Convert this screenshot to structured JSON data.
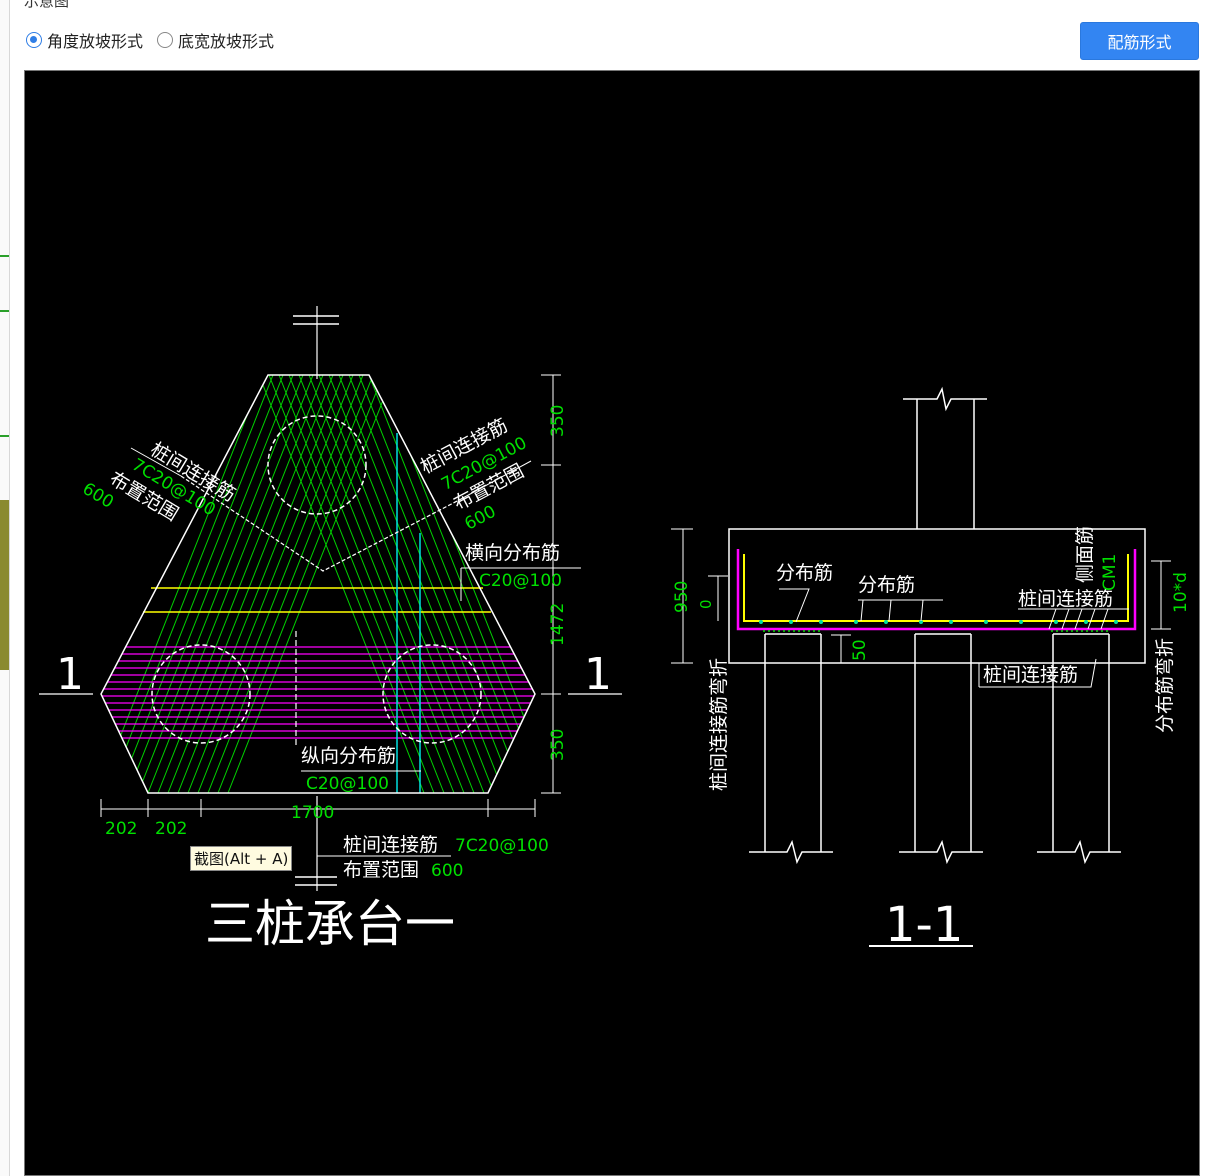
{
  "header": {
    "title": "示意图",
    "options": [
      {
        "label": "角度放坡形式",
        "checked": true
      },
      {
        "label": "底宽放坡形式",
        "checked": false
      }
    ],
    "button_label": "配筋形式"
  },
  "plan": {
    "title": "三桩承台一",
    "section_marks": [
      "1",
      "1"
    ],
    "dims": {
      "top": "350",
      "mid": "1472",
      "bottom": "350",
      "width": "1700",
      "edge_left": "202",
      "edge_right": "202"
    },
    "left_note": {
      "label": "桩间连接筋",
      "spec": "7C20@100",
      "range_label": "布置范围",
      "range_value": "600"
    },
    "right_note": {
      "label": "桩间连接筋",
      "spec": "7C20@100",
      "range_label": "布置范围",
      "range_value": "600"
    },
    "transverse": {
      "label": "横向分布筋",
      "spec": "C20@100"
    },
    "longitudinal": {
      "label": "纵向分布筋",
      "spec": "C20@100"
    },
    "bottom_note": {
      "label": "桩间连接筋",
      "spec": "7C20@100",
      "range_label": "布置范围",
      "range_value": "600"
    }
  },
  "section": {
    "title": "1-1",
    "dims": {
      "height": "950",
      "cover": "0",
      "embed": "50",
      "bend": "10*d"
    },
    "labels": {
      "dist1": "分布筋",
      "dist2": "分布筋",
      "side": "侧面筋",
      "side_spec": "CM1",
      "conn_top": "桩间连接筋",
      "conn_bottom": "桩间连接筋",
      "left_vertical": "桩间连接筋弯折",
      "right_vertical": "分布筋弯折"
    }
  },
  "tooltip": "截图(Alt + A)",
  "colors": {
    "green": "#00e000",
    "magenta": "#ff00ff",
    "yellow": "#ffff00",
    "cyan": "#00e0e0",
    "white": "#ffffff",
    "button": "#3385f2"
  }
}
